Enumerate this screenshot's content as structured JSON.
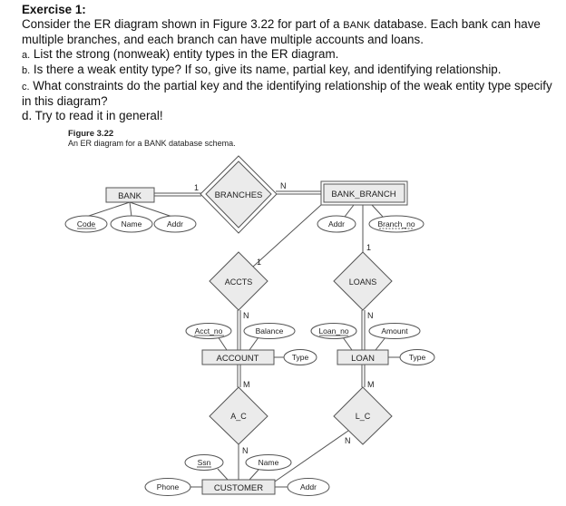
{
  "exercise": {
    "title": "Exercise 1:",
    "intro_1": "Consider the ER diagram shown in Figure 3.22 for part of a ",
    "intro_bank": "BANK",
    "intro_2": " database. Each bank can have",
    "intro_3": "multiple branches, and each branch can have multiple accounts and loans.",
    "items": [
      {
        "marker": "a.",
        "text": " List the strong (nonweak) entity types in the ER diagram."
      },
      {
        "marker": "b.",
        "text": " Is there a weak entity type? If so, give its name, partial key, and identifying relationship."
      },
      {
        "marker": "c.",
        "text": " What constraints do the partial key and the identifying relationship of the weak entity type specify"
      },
      {
        "marker": "",
        "text": "in this diagram?"
      },
      {
        "marker": "d.",
        "text": " Try to read it in general!"
      }
    ]
  },
  "figure": {
    "title": "Figure 3.22",
    "caption": "An ER diagram for a BANK database schema."
  },
  "diagram": {
    "entities": {
      "bank": "BANK",
      "bank_branch": "BANK_BRANCH",
      "account": "ACCOUNT",
      "loan": "LOAN",
      "customer": "CUSTOMER"
    },
    "relationships": {
      "branches": "BRANCHES",
      "accts": "ACCTS",
      "loans": "LOANS",
      "a_c": "A_C",
      "l_c": "L_C"
    },
    "attributes": {
      "bank_code": "Code",
      "bank_name": "Name",
      "bank_addr": "Addr",
      "branch_addr": "Addr",
      "branch_no": "Branch_no",
      "acct_no": "Acct_no",
      "balance": "Balance",
      "account_type": "Type",
      "loan_no": "Loan_no",
      "amount": "Amount",
      "loan_type": "Type",
      "ssn": "Ssn",
      "customer_name": "Name",
      "phone": "Phone",
      "customer_addr": "Addr"
    },
    "cardinalities": {
      "bank_branches": "1",
      "branches_branch": "N",
      "branch_accts": "1",
      "accts_account": "N",
      "branch_loans": "1",
      "loans_loan": "N",
      "account_ac": "M",
      "ac_customer": "N",
      "loan_lc": "M",
      "lc_customer": "N"
    },
    "colors": {
      "fill": "#ebebeb",
      "stroke": "#555555"
    }
  }
}
